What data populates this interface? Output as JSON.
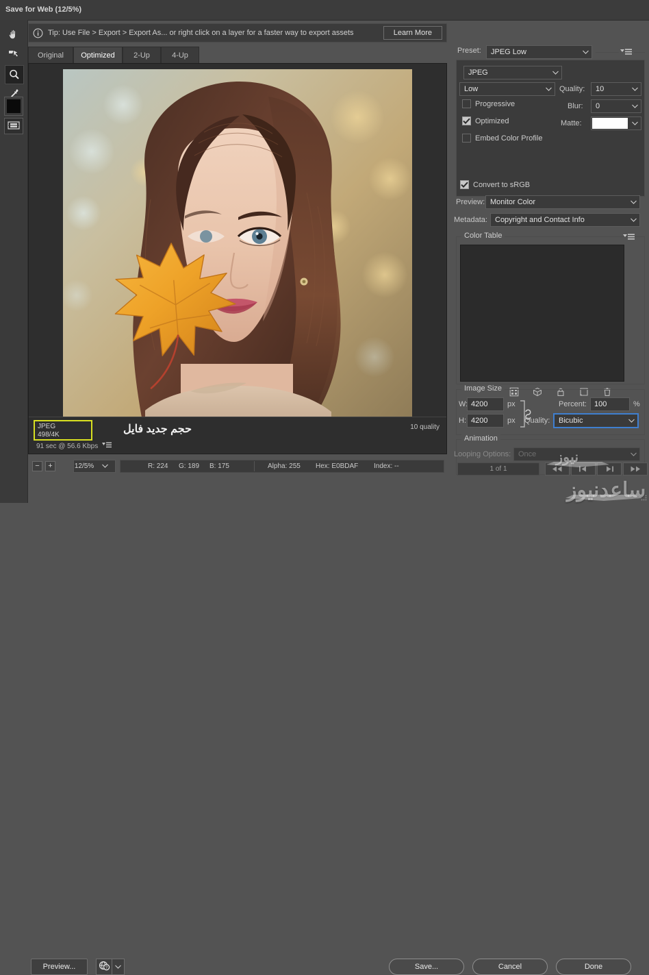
{
  "window": {
    "title": "Save for Web (12/5%)"
  },
  "toolbar": {
    "tools": [
      {
        "name": "hand-tool",
        "label": "Hand Tool",
        "selected": false
      },
      {
        "name": "slice-select-tool",
        "label": "Slice Select Tool",
        "selected": false
      },
      {
        "name": "zoom-tool",
        "label": "Zoom Tool",
        "selected": true
      },
      {
        "name": "eyedropper-tool",
        "label": "Eyedropper Tool",
        "selected": false
      }
    ],
    "foreground_color": "#0a0a0a",
    "toggle_slices_label": "Toggle Slices Visibility"
  },
  "tip": {
    "text": "Tip: Use File > Export > Export As...  or right click on a layer for a faster way to export assets",
    "learn_more": "Learn More"
  },
  "tabs": [
    {
      "label": "Original",
      "active": false
    },
    {
      "label": "Optimized",
      "active": true
    },
    {
      "label": "2-Up",
      "active": false
    },
    {
      "label": "4-Up",
      "active": false
    }
  ],
  "preview_info": {
    "format": "JPEG",
    "filesize": "498/4K",
    "speed": "91 sec @ 56.6 Kbps",
    "annotation": "حجم جدید فایل",
    "quality_note": "10 quality"
  },
  "statusbar": {
    "zoom_out": "−",
    "zoom_in": "+",
    "zoom_level": "12/5%",
    "r": "R: 224",
    "g": "G: 189",
    "b": "B: 175",
    "alpha": "Alpha: 255",
    "hex": "Hex: E0BDAF",
    "index": "Index: --"
  },
  "settings": {
    "preset_label": "Preset:",
    "preset_value": "JPEG Low",
    "format_value": "JPEG",
    "compression_value": "Low",
    "quality_label": "Quality:",
    "quality_value": "10",
    "progressive_label": "Progressive",
    "progressive_checked": false,
    "blur_label": "Blur:",
    "blur_value": "0",
    "optimized_label": "Optimized",
    "optimized_checked": true,
    "matte_label": "Matte:",
    "matte_color": "#ffffff",
    "embed_profile_label": "Embed Color Profile",
    "embed_profile_checked": false,
    "convert_srgb_label": "Convert to sRGB",
    "convert_srgb_checked": true,
    "preview_label": "Preview:",
    "preview_value": "Monitor Color",
    "metadata_label": "Metadata:",
    "metadata_value": "Copyright and Contact Info"
  },
  "color_table": {
    "title": "Color Table",
    "icons": [
      {
        "name": "transparency-dither-icon",
        "label": "Maps selected colors to transparent"
      },
      {
        "name": "web-shift-icon",
        "label": "Shifts selected colors to web palette"
      },
      {
        "name": "lock-icon",
        "label": "Locks selected colors"
      },
      {
        "name": "new-color-icon",
        "label": "New color"
      },
      {
        "name": "delete-color-icon",
        "label": "Deletes selected colors"
      }
    ]
  },
  "image_size": {
    "title": "Image Size",
    "w_label": "W:",
    "w_value": "4200",
    "w_unit": "px",
    "h_label": "H:",
    "h_value": "4200",
    "h_unit": "px",
    "percent_label": "Percent:",
    "percent_value": "100",
    "percent_unit": "%",
    "quality_label": "Quality:",
    "quality_value": "Bicubic"
  },
  "animation": {
    "title": "Animation",
    "looping_label": "Looping Options:",
    "looping_value": "Once",
    "frame_counter": "1 of 1",
    "buttons": [
      {
        "name": "first-frame-button",
        "glyph": "◀◀"
      },
      {
        "name": "previous-frame-button",
        "glyph": "◀|"
      },
      {
        "name": "play-frame-button",
        "glyph": "|▶"
      },
      {
        "name": "last-frame-button",
        "glyph": "▶▶"
      }
    ]
  },
  "actions": {
    "preview_label": "Preview...",
    "browser_select_label": "Select Browser",
    "save_label": "Save...",
    "cancel_label": "Cancel",
    "done_label": "Done"
  },
  "watermarks": {
    "site_text": "ساعدنیوز",
    "news_text": "نیوز"
  },
  "colors": {
    "window_bg": "#535353",
    "panel_bg": "#3b3b3b",
    "titlebar_bg": "#3c3c3c",
    "canvas_bg": "#2e2e2e",
    "color_table_bg": "#2b2b2b",
    "accent_focus": "#3f7fd0",
    "badge_outline": "#d9e021",
    "text": "#c8c8c8"
  }
}
